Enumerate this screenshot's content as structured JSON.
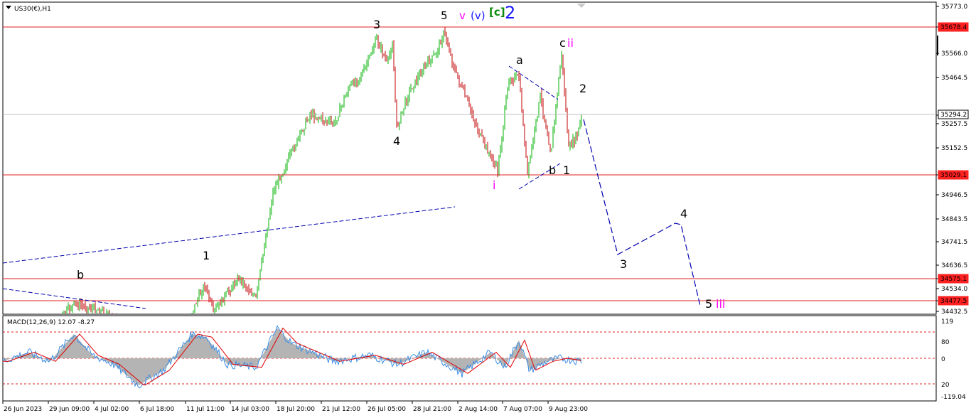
{
  "chart": {
    "symbol_label": "US30(€),H1",
    "header_marks": [
      {
        "text": "5",
        "color": "#000000"
      },
      {
        "text": "v",
        "color": "#ff00ff"
      },
      {
        "text": "(v)",
        "color": "#1a1aff"
      },
      {
        "text": "[c]",
        "color": "#0a8a0a"
      },
      {
        "text": "2",
        "color": "#1a1aff"
      }
    ],
    "y_ticks": [
      "35773.0",
      "35678.4",
      "35566.0",
      "35464.5",
      "35294.2",
      "35257.5",
      "35152.5",
      "35029.1",
      "34946.5",
      "34843.5",
      "34741.5",
      "34636.5",
      "34575.1",
      "34534.0",
      "34477.5",
      "34432.5"
    ],
    "price_tags": [
      {
        "text": "35678.4",
        "color": "#ff2020"
      },
      {
        "text": "35294.2",
        "color": "#ffffff"
      },
      {
        "text": "35029.1",
        "color": "#ff2020"
      },
      {
        "text": "34575.1",
        "color": "#ff2020"
      },
      {
        "text": "34477.5",
        "color": "#ff2020"
      }
    ],
    "wave_labels": [
      {
        "text": "3",
        "color": "#000000"
      },
      {
        "text": "4",
        "color": "#000000"
      },
      {
        "text": "a",
        "color": "#000000"
      },
      {
        "text": "c",
        "color": "#000000"
      },
      {
        "text": "ii",
        "color": "#ff00ff"
      },
      {
        "text": "2",
        "color": "#000000"
      },
      {
        "text": "i",
        "color": "#ff00ff"
      },
      {
        "text": "b",
        "color": "#000000"
      },
      {
        "text": "1",
        "color": "#000000"
      },
      {
        "text": "4",
        "color": "#000000"
      },
      {
        "text": "3",
        "color": "#000000"
      },
      {
        "text": "5",
        "color": "#000000"
      },
      {
        "text": "iii",
        "color": "#ff00ff"
      },
      {
        "text": "1",
        "color": "#000000"
      },
      {
        "text": "b",
        "color": "#000000"
      }
    ],
    "x_ticks": [
      "26 Jun 2023",
      "29 Jun 09:00",
      "4 Jul 02:00",
      "6 Jul 18:00",
      "11 Jul 11:00",
      "14 Jul 03:00",
      "18 Jul 20:00",
      "21 Jul 12:00",
      "26 Jul 05:00",
      "28 Jul 21:00",
      "2 Aug 14:00",
      "7 Aug 07:00",
      "9 Aug 23:00"
    ]
  },
  "macd": {
    "label": "MACD(12,26,9) 12.07 -8.27",
    "y_ticks": [
      "119",
      "80",
      "0",
      "20",
      "-119.04"
    ]
  },
  "chart_data": {
    "type": "candlestick",
    "symbol": "US30(€)",
    "timeframe": "H1",
    "horizontal_levels": [
      35678.4,
      35029.1,
      34575.1,
      34477.5
    ],
    "current_price": 35294.2,
    "price_range": [
      34432.5,
      35773.0
    ],
    "projection_path": [
      {
        "label": "2",
        "price": 35300
      },
      {
        "label": "3",
        "price": 34700
      },
      {
        "label": "4",
        "price": 34830
      },
      {
        "label": "5 iii",
        "price": 34450
      }
    ]
  },
  "colors": {
    "bull_candle": "#00b000",
    "bear_candle": "#c00000",
    "level_line": "#e02020",
    "trend_line": "#0000b0",
    "macd_hist": "#b4b4b4",
    "macd_line": "#3a8ee6",
    "signal_line": "#e00000"
  }
}
